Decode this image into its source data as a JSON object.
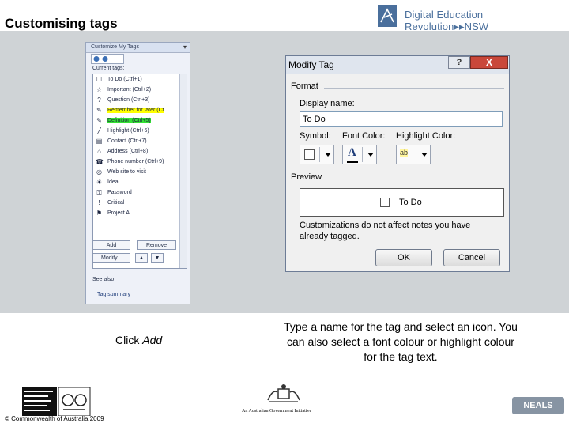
{
  "slide": {
    "title": "Customising tags",
    "banner_text": "Digital Education Revolution▸▸NSW",
    "click_prefix": "Click ",
    "click_action": "Add",
    "description": "Type a name for the tag and select an icon. You can also select a font colour or highlight colour for the tag text.",
    "copyright": "© Commonwealth of Australia 2009",
    "gov_initiative": "An Australian Government Initiative",
    "neals": "NEALS"
  },
  "task_pane": {
    "title": "Customize My Tags",
    "current_tags_label": "Current tags:",
    "tags": [
      {
        "label": "To Do (Ctrl+1)",
        "icon": "checkbox-icon",
        "glyph": "☐"
      },
      {
        "label": "Important (Ctrl+2)",
        "icon": "star-icon",
        "glyph": "☆"
      },
      {
        "label": "Question (Ctrl+3)",
        "icon": "question-icon",
        "glyph": "?"
      },
      {
        "label": "Remember for later (Ct",
        "icon": "highlighter-icon",
        "glyph": "✎"
      },
      {
        "label": "Definition (Ctrl+5)",
        "icon": "highlighter-icon",
        "glyph": "✎"
      },
      {
        "label": "Highlight (Ctrl+6)",
        "icon": "pen-icon",
        "glyph": "╱"
      },
      {
        "label": "Contact (Ctrl+7)",
        "icon": "contact-card-icon",
        "glyph": "▤"
      },
      {
        "label": "Address (Ctrl+8)",
        "icon": "house-icon",
        "glyph": "⌂"
      },
      {
        "label": "Phone number (Ctrl+9)",
        "icon": "phone-icon",
        "glyph": "☎"
      },
      {
        "label": "Web site to visit",
        "icon": "globe-icon",
        "glyph": "◎"
      },
      {
        "label": "Idea",
        "icon": "lightbulb-icon",
        "glyph": "☀"
      },
      {
        "label": "Password",
        "icon": "key-icon",
        "glyph": "⚿"
      },
      {
        "label": "Critical",
        "icon": "exclamation-icon",
        "glyph": "!"
      },
      {
        "label": "Project A",
        "icon": "flag-icon",
        "glyph": "⚑"
      }
    ],
    "add_label": "Add",
    "remove_label": "Remove",
    "modify_label": "Modify...",
    "see_also_label": "See also",
    "tag_summary_label": "Tag summary"
  },
  "dialog": {
    "title": "Modify Tag",
    "help_label": "?",
    "close_label": "X",
    "format_label": "Format",
    "display_name_label": "Display name:",
    "display_name_value": "To Do",
    "symbol_label": "Symbol:",
    "font_color_label": "Font Color:",
    "font_color_glyph": "A",
    "highlight_color_label": "Highlight Color:",
    "highlight_glyph": "ab",
    "preview_label": "Preview",
    "preview_text": "To Do",
    "note": "Customizations do not affect notes you have already tagged.",
    "ok_label": "OK",
    "cancel_label": "Cancel"
  },
  "colors": {
    "band": "#cfd3d6",
    "highlight_yellow": "#ffff00",
    "highlight_green": "#34e334",
    "brand_blue": "#4a6f9c"
  }
}
